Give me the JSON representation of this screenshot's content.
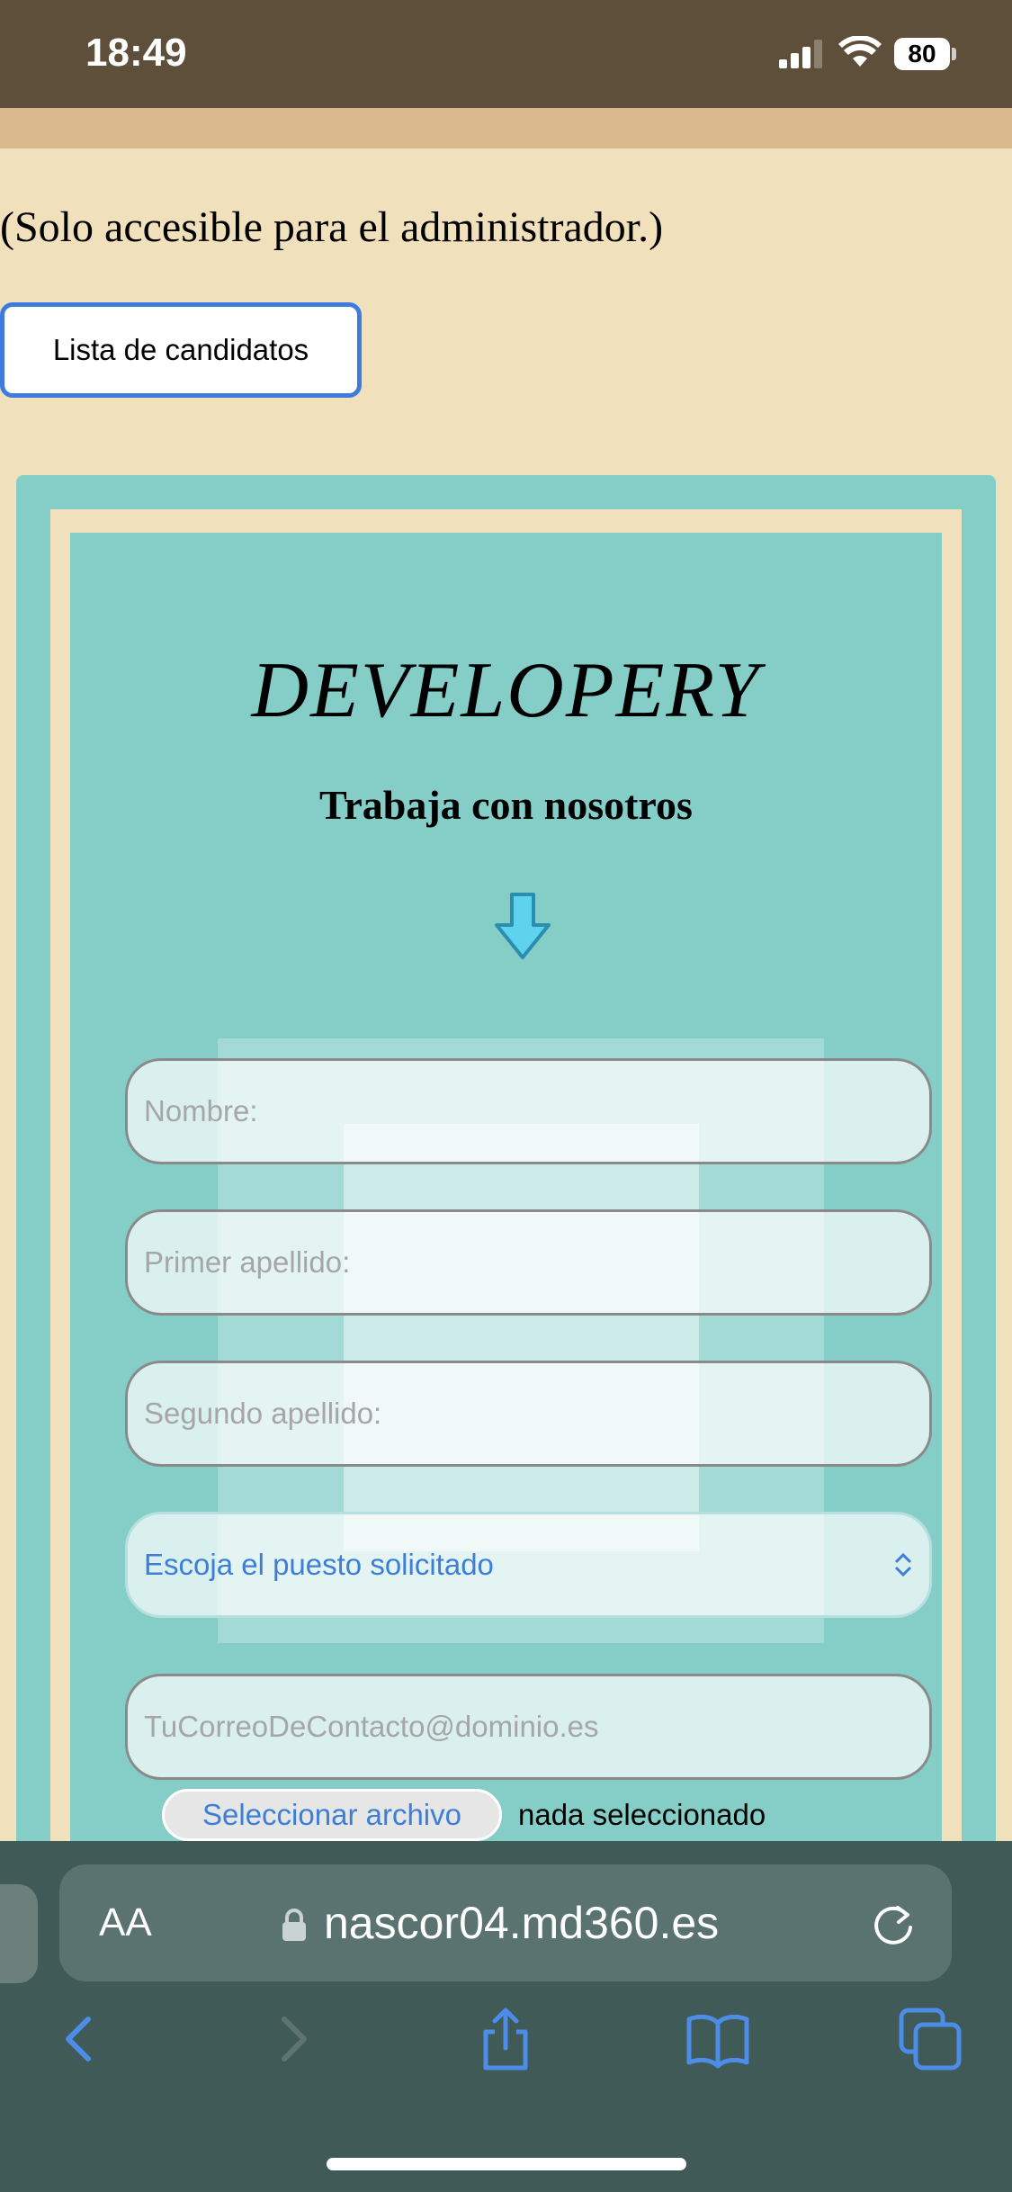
{
  "status_bar": {
    "time": "18:49",
    "battery": "80"
  },
  "page": {
    "admin_note": "(Solo accesible para el administrador.)",
    "candidates_button": "Lista de candidatos"
  },
  "form": {
    "brand": "DEVELOPERY",
    "subtitle": "Trabaja con nosotros",
    "fields": {
      "nombre_placeholder": "Nombre:",
      "primer_apellido_placeholder": "Primer apellido:",
      "segundo_apellido_placeholder": "Segundo apellido:",
      "puesto_select": "Escoja el puesto solicitado",
      "email_placeholder": "TuCorreoDeContacto@dominio.es"
    },
    "file": {
      "button": "Seleccionar archivo",
      "status": "nada seleccionado"
    }
  },
  "browser": {
    "aa_label": "AA",
    "url": "nascor04.md360.es"
  },
  "icons": {
    "arrow": "arrow-down-icon",
    "lock": "lock-icon",
    "reload": "reload-icon",
    "back": "back-icon",
    "forward": "forward-icon",
    "share": "share-icon",
    "bookmarks": "bookmarks-icon",
    "tabs": "tabs-icon"
  },
  "colors": {
    "accent": "#3f7ae0",
    "panel": "#84cec7",
    "background": "#f0e0bb",
    "chrome": "#3f5a57"
  }
}
